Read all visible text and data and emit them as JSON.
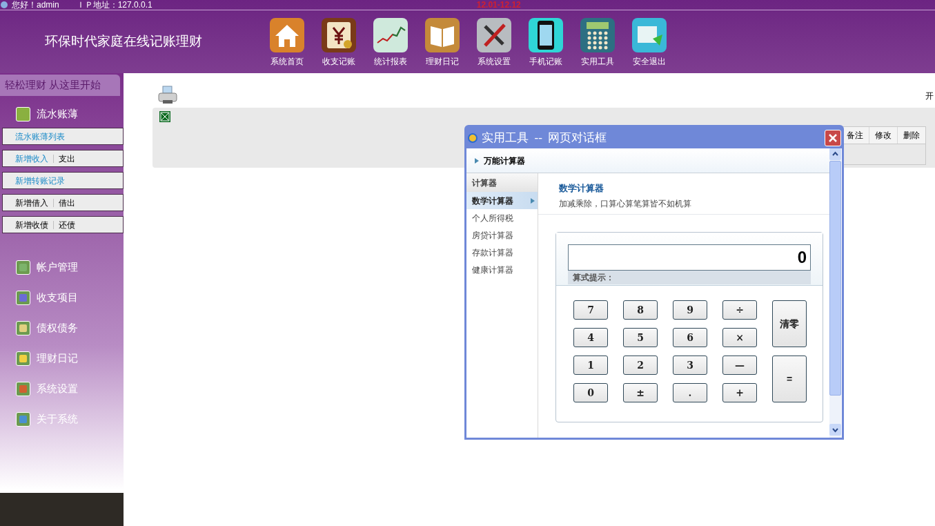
{
  "top_bar": {
    "greeting": "您好！admin",
    "ip": "ＩＰ地址：127.0.0.1",
    "notice": "12.01-12.12"
  },
  "header": {
    "site_title": "环保时代家庭在线记账理财",
    "nav": [
      {
        "label": "系统首页"
      },
      {
        "label": "收支记账"
      },
      {
        "label": "统计报表"
      },
      {
        "label": "理财日记"
      },
      {
        "label": "系统设置"
      },
      {
        "label": "手机记账"
      },
      {
        "label": "实用工具"
      },
      {
        "label": "安全退出"
      }
    ]
  },
  "sidebar": {
    "slogan": "轻松理财 从这里开始",
    "section": {
      "title": "流水账薄",
      "rows": [
        [
          {
            "label": "流水账薄列表",
            "highlighted": true
          }
        ],
        [
          {
            "label": "新增收入",
            "highlighted": true
          },
          {
            "label": "支出",
            "highlighted": false
          }
        ],
        [
          {
            "label": "新增转账记录",
            "highlighted": true
          }
        ],
        [
          {
            "label": "新增借入",
            "highlighted": false
          },
          {
            "label": "借出",
            "highlighted": false
          }
        ],
        [
          {
            "label": "新增收债",
            "highlighted": false
          },
          {
            "label": "还债",
            "highlighted": false
          }
        ]
      ]
    },
    "groups": [
      {
        "label": "帐户管理"
      },
      {
        "label": "收支项目"
      },
      {
        "label": "债权债务"
      },
      {
        "label": "理财日记"
      },
      {
        "label": "系统设置"
      },
      {
        "label": "关于系统"
      }
    ]
  },
  "main": {
    "corner_text": "开",
    "table_columns": [
      "备注",
      "修改",
      "删除"
    ]
  },
  "dialog": {
    "title": "实用工具  --  网页对话框",
    "heading": "万能计算器",
    "menu_title": "计算器",
    "menu": [
      {
        "label": "数学计算器",
        "selected": true
      },
      {
        "label": "个人所得税",
        "selected": false
      },
      {
        "label": "房贷计算器",
        "selected": false
      },
      {
        "label": "存款计算器",
        "selected": false
      },
      {
        "label": "健康计算器",
        "selected": false
      }
    ],
    "tool_title": "数学计算器",
    "tool_subtitle": "加减乘除，口算心算笔算皆不如机算",
    "display": "0",
    "hint_label": "算式提示：",
    "keys": [
      [
        "7",
        "8",
        "9",
        "÷"
      ],
      [
        "4",
        "5",
        "6",
        "×"
      ],
      [
        "1",
        "2",
        "3",
        "—"
      ],
      [
        "0",
        "±",
        ".",
        "+"
      ]
    ],
    "side_keys": [
      "清零",
      "="
    ]
  }
}
